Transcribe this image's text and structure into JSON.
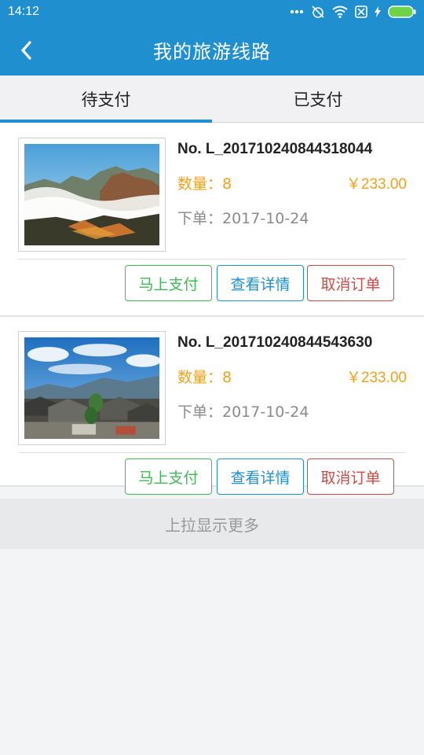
{
  "status_bar": {
    "time": "14:12",
    "icons": [
      "more-dots-icon",
      "alarm-off-icon",
      "wifi-icon",
      "no-sim-icon",
      "charging-icon",
      "battery-icon"
    ]
  },
  "header": {
    "title": "我的旅游线路",
    "back_icon": "chevron-left-icon"
  },
  "tabs": [
    {
      "label": "待支付",
      "active": true
    },
    {
      "label": "已支付",
      "active": false
    }
  ],
  "orders": [
    {
      "order_no": "No. L_201710240844318044",
      "quantity": "数量：8",
      "price": "￥233.00",
      "date": "下单：2017-10-24",
      "image": "mountain-sea-of-clouds",
      "actions": {
        "pay": "马上支付",
        "detail": "查看详情",
        "cancel": "取消订单"
      }
    },
    {
      "order_no": "No. L_201710240844543630",
      "quantity": "数量：8",
      "price": "￥233.00",
      "date": "下单：2017-10-24",
      "image": "old-town-rooftops",
      "actions": {
        "pay": "马上支付",
        "detail": "查看详情",
        "cancel": "取消订单"
      }
    }
  ],
  "load_more": "上拉显示更多",
  "colors": {
    "primary": "#1f8fd0",
    "accent_orange": "#f0a21b",
    "pay_green": "#3fba55",
    "cancel_red": "#cc4a44"
  }
}
